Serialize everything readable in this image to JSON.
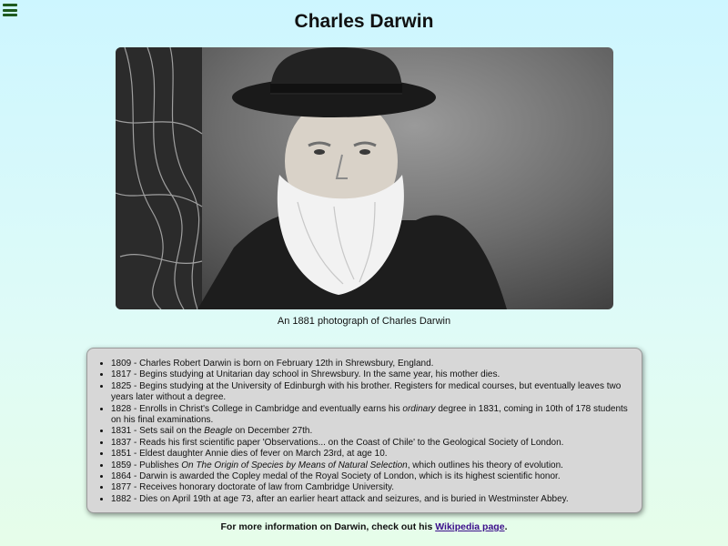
{
  "header": {
    "menu_icon": "hamburger-menu-icon",
    "title": "Charles Darwin"
  },
  "photo": {
    "caption": "An 1881 photograph of Charles Darwin"
  },
  "timeline": [
    {
      "before": "1809 - Charles Robert Darwin is born on February 12th in Shrewsbury, England.",
      "em": "",
      "after": ""
    },
    {
      "before": "1817 - Begins studying at Unitarian day school in Shrewsbury. In the same year, his mother dies.",
      "em": "",
      "after": ""
    },
    {
      "before": "1825 - Begins studying at the University of Edinburgh with his brother. Registers for medical courses, but eventually leaves two years later without a degree.",
      "em": "",
      "after": ""
    },
    {
      "before": "1828 - Enrolls in Christ's College in Cambridge and eventually earns his ",
      "em": "ordinary",
      "after": " degree in 1831, coming in 10th of 178 students on his final examinations."
    },
    {
      "before": "1831 - Sets sail on the ",
      "em": "Beagle",
      "after": " on December 27th."
    },
    {
      "before": "1837 - Reads his first scientific paper 'Observations... on the Coast of Chile' to the Geological Society of London.",
      "em": "",
      "after": ""
    },
    {
      "before": "1851 - Eldest daughter Annie dies of fever on March 23rd, at age 10.",
      "em": "",
      "after": ""
    },
    {
      "before": "1859 - Publishes ",
      "em": "On The Origin of Species by Means of Natural Selection",
      "after": ", which outlines his theory of evolution."
    },
    {
      "before": "1864 - Darwin is awarded the Copley medal of the Royal Society of London, which is its highest scientific honor.",
      "em": "",
      "after": ""
    },
    {
      "before": "1877 - Receives honorary doctorate of law from Cambridge University.",
      "em": "",
      "after": ""
    },
    {
      "before": "1882 - Dies on April 19th at age 73, after an earlier heart attack and seizures, and is buried in Westminster Abbey.",
      "em": "",
      "after": ""
    }
  ],
  "footer": {
    "text_before": "For more information on Darwin, check out his ",
    "link_text": "Wikipedia page",
    "text_after": "."
  }
}
